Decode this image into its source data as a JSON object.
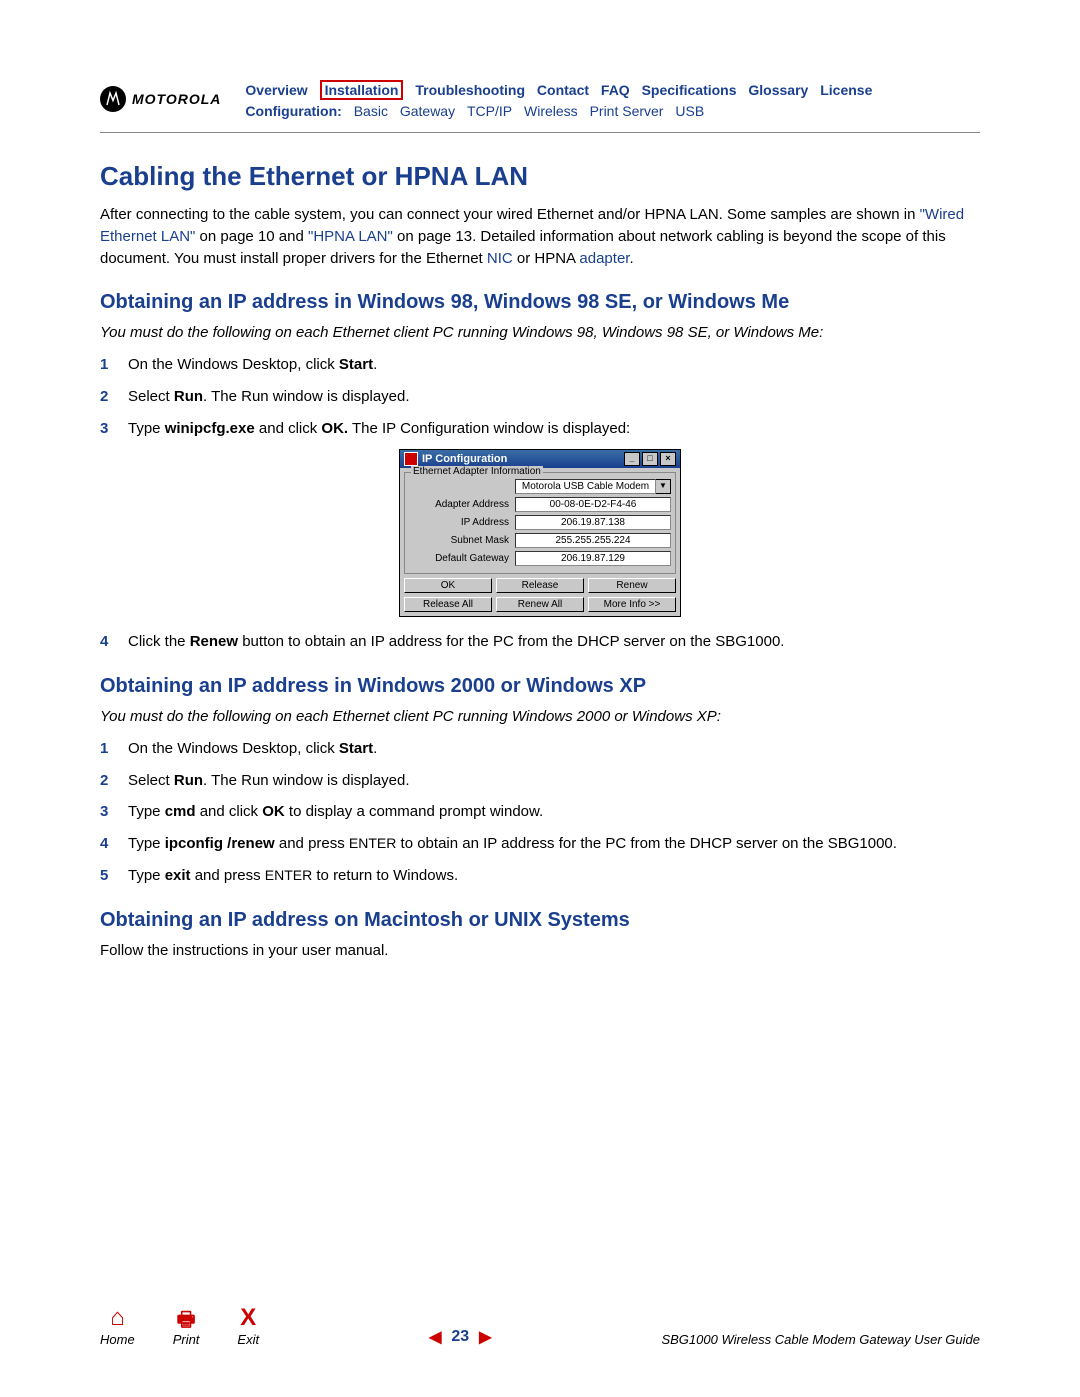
{
  "brand": "MOTOROLA",
  "nav_row1": [
    "Overview",
    "Installation",
    "Troubleshooting",
    "Contact",
    "FAQ",
    "Specifications",
    "Glossary",
    "License"
  ],
  "nav_row2_label": "Configuration:",
  "nav_row2": [
    "Basic",
    "Gateway",
    "TCP/IP",
    "Wireless",
    "Print Server",
    "USB"
  ],
  "h1": "Cabling the Ethernet or HPNA LAN",
  "intro": {
    "p1a": "After connecting to the cable system, you can connect your wired Ethernet and/or HPNA LAN. Some samples are shown in ",
    "link1": "\"Wired Ethernet LAN\"",
    "p1b": " on page 10 and ",
    "link2": "\"HPNA LAN\"",
    "p1c": " on page 13. Detailed information about network cabling is beyond the scope of this document. You must install proper drivers for the Ethernet ",
    "link3": "NIC",
    "p1d": " or HPNA ",
    "link4": "adapter",
    "p1e": "."
  },
  "sec1": {
    "heading": "Obtaining an IP address in Windows 98, Windows 98 SE, or Windows Me",
    "lead": "You must do the following on each Ethernet client PC running Windows 98, Windows 98 SE, or Windows Me:",
    "steps": {
      "s1a": "On the Windows Desktop, click ",
      "s1b": "Start",
      "s1c": ".",
      "s2a": "Select ",
      "s2b": "Run",
      "s2c": ". The Run window is displayed.",
      "s3a": "Type ",
      "s3b": "winipcfg.exe",
      "s3c": " and click ",
      "s3d": "OK.",
      "s3e": " The IP Configuration window is displayed:",
      "s4a": "Click the ",
      "s4b": "Renew",
      "s4c": " button to obtain an IP address for the PC from the DHCP server on the SBG1000."
    }
  },
  "ipcfg": {
    "title": "IP Configuration",
    "group": "Ethernet Adapter Information",
    "adapter": "Motorola USB Cable Modem",
    "rows": {
      "addr_lbl": "Adapter Address",
      "addr_val": "00-08-0E-D2-F4-46",
      "ip_lbl": "IP Address",
      "ip_val": "206.19.87.138",
      "mask_lbl": "Subnet Mask",
      "mask_val": "255.255.255.224",
      "gw_lbl": "Default Gateway",
      "gw_val": "206.19.87.129"
    },
    "btns": [
      "OK",
      "Release",
      "Renew",
      "Release All",
      "Renew All",
      "More Info >>"
    ]
  },
  "sec2": {
    "heading": "Obtaining an IP address in Windows 2000 or Windows XP",
    "lead": "You must do the following on each Ethernet client PC running Windows 2000 or Windows XP:",
    "steps": {
      "s1a": "On the Windows Desktop, click ",
      "s1b": "Start",
      "s1c": ".",
      "s2a": "Select ",
      "s2b": "Run",
      "s2c": ". The Run window is displayed.",
      "s3a": "Type ",
      "s3b": "cmd",
      "s3c": " and click ",
      "s3d": "OK",
      "s3e": " to display a command prompt window.",
      "s4a": "Type ",
      "s4b": "ipconfig /renew",
      "s4c": " and press ",
      "s4d": "ENTER",
      "s4e": " to obtain an IP address for the PC from the DHCP server on the SBG1000.",
      "s5a": "Type ",
      "s5b": "exit",
      "s5c": " and press ",
      "s5d": "ENTER",
      "s5e": " to return to Windows."
    }
  },
  "sec3": {
    "heading": "Obtaining an IP address on Macintosh or UNIX Systems",
    "body": "Follow the instructions in your user manual."
  },
  "footer": {
    "home": "Home",
    "print": "Print",
    "exit": "Exit",
    "page": "23",
    "guide": "SBG1000 Wireless Cable Modem Gateway User Guide"
  }
}
